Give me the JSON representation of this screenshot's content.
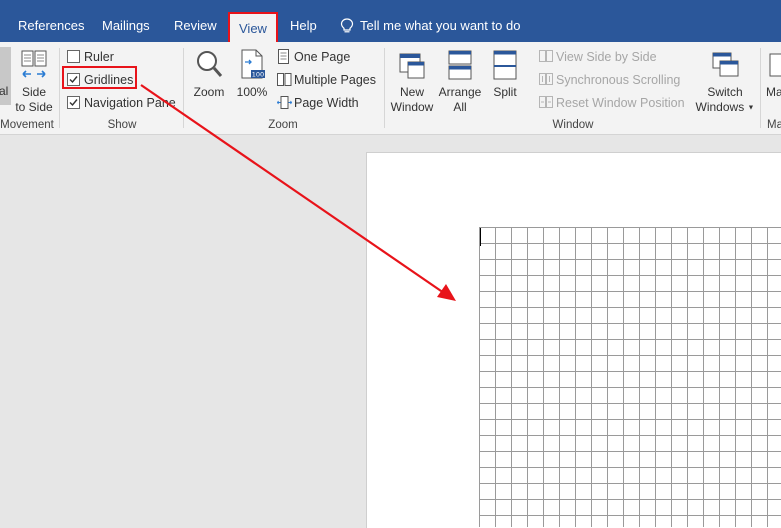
{
  "tabs": {
    "references": "References",
    "mailings": "Mailings",
    "review": "Review",
    "view": "View",
    "help": "Help",
    "tell_me": "Tell me what you want to do"
  },
  "ribbon": {
    "movement": {
      "partial_label": "al",
      "side_to_side_line1": "Side",
      "side_to_side_line2": "to Side",
      "group_label": "Movement"
    },
    "show": {
      "ruler": "Ruler",
      "ruler_checked": false,
      "gridlines": "Gridlines",
      "gridlines_checked": true,
      "navigation_pane": "Navigation Pane",
      "navigation_pane_checked": true,
      "group_label": "Show"
    },
    "zoom": {
      "zoom": "Zoom",
      "hundred": "100%",
      "one_page": "One Page",
      "multiple_pages": "Multiple Pages",
      "page_width": "Page Width",
      "group_label": "Zoom"
    },
    "window": {
      "new_window_line1": "New",
      "new_window_line2": "Window",
      "arrange_all_line1": "Arrange",
      "arrange_all_line2": "All",
      "split": "Split",
      "view_side_by_side": "View Side by Side",
      "synchronous_scrolling": "Synchronous Scrolling",
      "reset_window_position": "Reset Window Position",
      "switch_windows_line1": "Switch",
      "switch_windows_line2": "Windows",
      "group_label": "Window"
    },
    "macros": {
      "partial_label": "Ma",
      "group_partial": "Ma"
    }
  },
  "colors": {
    "tab_bar": "#2b579a",
    "ribbon_bg": "#f3f3f3",
    "highlight": "#e8131a",
    "canvas": "#e6e6e6"
  }
}
